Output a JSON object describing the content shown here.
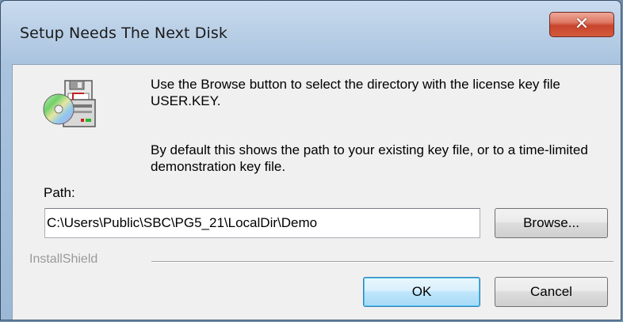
{
  "window": {
    "title": "Setup Needs The Next Disk",
    "close_glyph": "✕"
  },
  "dialog": {
    "icon": "disk-install-icon",
    "message_1": "Use the Browse button to select the directory with the license key file USER.KEY.",
    "message_2": "By default this shows the path to your existing key file, or to a time-limited demonstration key file.",
    "path_label": "Path:",
    "path_value": "C:\\Users\\Public\\SBC\\PG5_21\\LocalDir\\Demo",
    "browse_label": "Browse...",
    "brand": "InstallShield",
    "ok_label": "OK",
    "cancel_label": "Cancel"
  },
  "colors": {
    "title_bar": "#b9cfe6",
    "close_button": "#c8442c",
    "default_button": "#bee6fd",
    "client_background": "#f0f0f0"
  }
}
